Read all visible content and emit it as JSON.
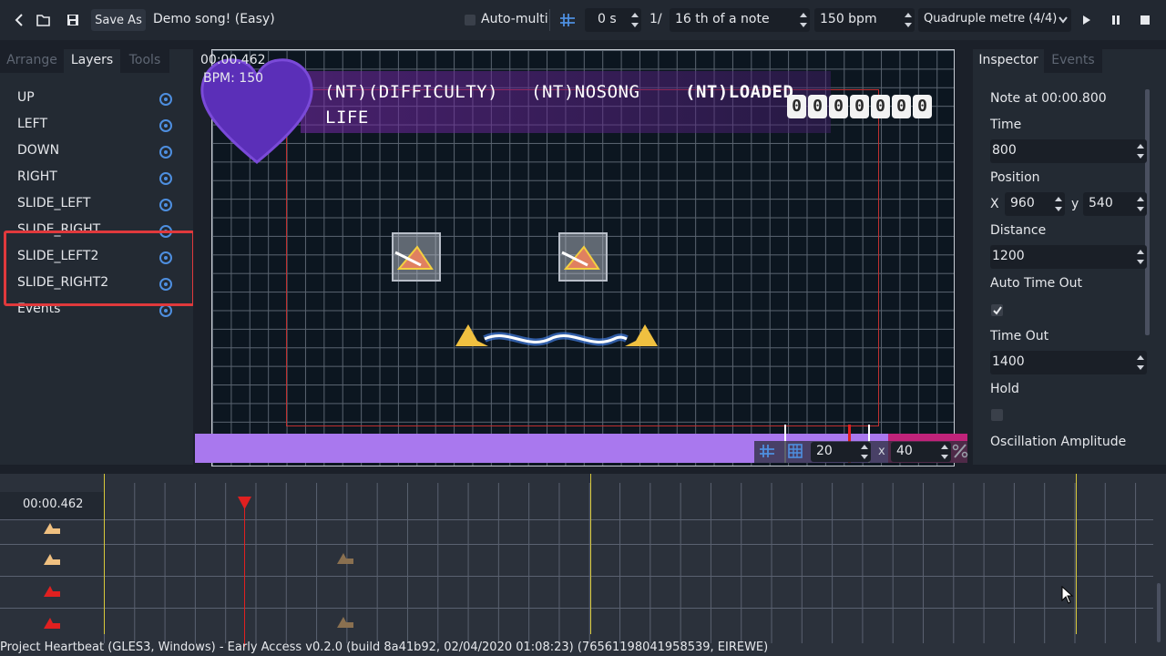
{
  "toolbar": {
    "back_icon": "chevron-left-icon",
    "open_icon": "folder-open-icon",
    "save_icon": "save-icon",
    "save_as_label": "Save As",
    "song_title": "Demo song! (Easy)",
    "auto_multi_label": "Auto-multi",
    "snap_icon": "snap-icon",
    "offset_value": "0 s",
    "divisor_prefix": "1/",
    "divisor_value": "16 th of a note",
    "bpm_value": "150 bpm",
    "metre_value": "Quadruple metre (4/4)",
    "play_icon": "play-icon",
    "pause_icon": "pause-icon",
    "stop_icon": "stop-icon"
  },
  "left_tabs": [
    "Arrange",
    "Layers",
    "Tools"
  ],
  "layers": [
    {
      "label": "UP"
    },
    {
      "label": "LEFT"
    },
    {
      "label": "DOWN"
    },
    {
      "label": "RIGHT"
    },
    {
      "label": "SLIDE_LEFT"
    },
    {
      "label": "SLIDE_RIGHT"
    },
    {
      "label": "SLIDE_LEFT2"
    },
    {
      "label": "SLIDE_RIGHT2"
    },
    {
      "label": "Events"
    }
  ],
  "viewport": {
    "time": "00:00.462",
    "bpm": "BPM: 150",
    "difficulty": "(NT)(DIFFICULTY)",
    "song": "(NT)NOSONG",
    "loaded": "(NT)LOADED",
    "life": "LIFE",
    "score": [
      "0",
      "0",
      "0",
      "0",
      "0",
      "0",
      "0"
    ],
    "grid_x": "20",
    "grid_y": "40",
    "grid_x_sep": "x"
  },
  "inspector_tabs": [
    "Inspector",
    "Events"
  ],
  "inspector": {
    "note_at": "Note at 00:00.800",
    "time_label": "Time",
    "time_value": "800",
    "position_label": "Position",
    "x_label": "X",
    "x_value": "960",
    "y_label": "y",
    "y_value": "540",
    "distance_label": "Distance",
    "distance_value": "1200",
    "auto_timeout_label": "Auto Time Out",
    "auto_timeout_checked": true,
    "timeout_label": "Time Out",
    "timeout_value": "1400",
    "hold_label": "Hold",
    "hold_checked": false,
    "oscillation_label": "Oscillation Amplitude"
  },
  "timeline": {
    "time": "00:00.462"
  },
  "status_bar": "Project Heartbeat (GLES3, Windows) - Early Access v0.2.0 (build 8a41b92, 02/04/2020  01:08:23) (76561198041958539, EIREWE)"
}
